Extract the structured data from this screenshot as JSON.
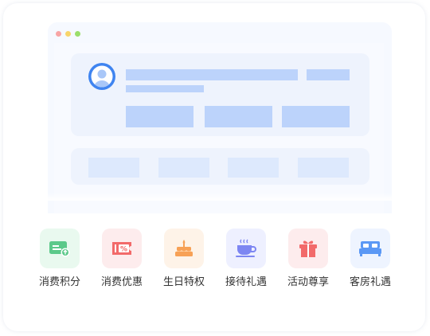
{
  "features": [
    {
      "label": "消费积分",
      "icon": "points-card-icon",
      "bg": "#e9f9ef",
      "color": "#5cc98a"
    },
    {
      "label": "消费优惠",
      "icon": "discount-coupon-icon",
      "bg": "#fdeced",
      "color": "#f26a6a"
    },
    {
      "label": "生日特权",
      "icon": "birthday-cake-icon",
      "bg": "#fef3e8",
      "color": "#f7a156"
    },
    {
      "label": "接待礼遇",
      "icon": "coffee-cup-icon",
      "bg": "#eef0ff",
      "color": "#7d86f2"
    },
    {
      "label": "活动尊享",
      "icon": "gift-icon",
      "bg": "#fdeced",
      "color": "#f26a6a"
    },
    {
      "label": "客房礼遇",
      "icon": "bed-icon",
      "bg": "#eef4ff",
      "color": "#5b98f5"
    }
  ]
}
